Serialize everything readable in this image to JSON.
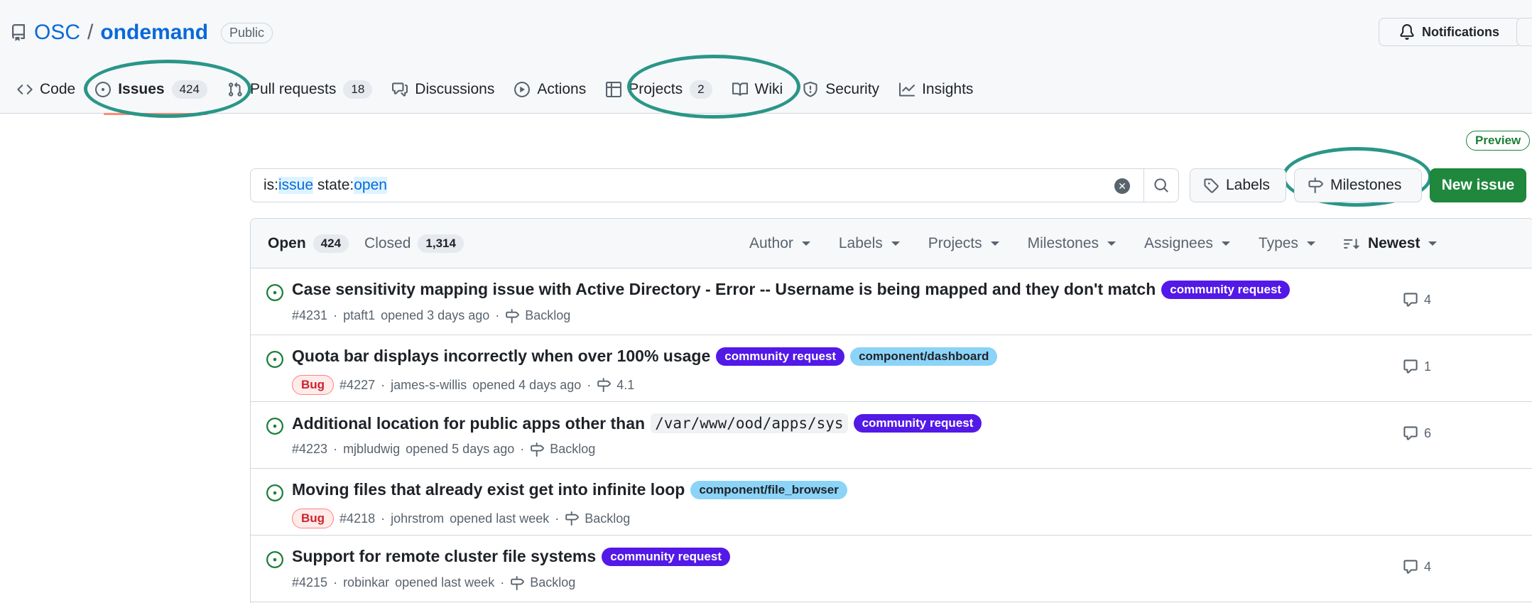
{
  "repo": {
    "owner": "OSC",
    "separator": "/",
    "name": "ondemand",
    "visibility": "Public"
  },
  "header": {
    "notifications_label": "Notifications"
  },
  "tabs": [
    {
      "label": "Code",
      "icon": "code-icon"
    },
    {
      "label": "Issues",
      "count": "424",
      "icon": "issue-opened-icon",
      "selected": true
    },
    {
      "label": "Pull requests",
      "count": "18",
      "icon": "git-pull-request-icon"
    },
    {
      "label": "Discussions",
      "icon": "comment-discussion-icon"
    },
    {
      "label": "Actions",
      "icon": "play-icon"
    },
    {
      "label": "Projects",
      "count": "2",
      "icon": "table-icon"
    },
    {
      "label": "Wiki",
      "icon": "book-icon"
    },
    {
      "label": "Security",
      "icon": "shield-icon"
    },
    {
      "label": "Insights",
      "icon": "graph-icon"
    }
  ],
  "toolbar": {
    "preview_badge": "Preview",
    "search": {
      "k1": "is:",
      "v1": "issue",
      "k2": " state:",
      "v2": "open"
    },
    "labels_button": "Labels",
    "milestones_button": "Milestones",
    "new_issue_button": "New issue"
  },
  "list": {
    "open_label": "Open",
    "open_count": "424",
    "closed_label": "Closed",
    "closed_count": "1,314",
    "filters": [
      "Author",
      "Labels",
      "Projects",
      "Milestones",
      "Assignees",
      "Types"
    ],
    "sort_label": "Newest"
  },
  "issues": [
    {
      "title": "Case sensitivity mapping issue with Active Directory - Error -- Username is being mapped and they don't match",
      "labels": [
        {
          "name": "community request",
          "kind": "community"
        }
      ],
      "bug": false,
      "number": "#4231",
      "author": "ptaft1",
      "opened": "opened 3 days ago",
      "milestone": "Backlog",
      "comments": "4"
    },
    {
      "title": "Quota bar displays incorrectly when over 100% usage",
      "labels": [
        {
          "name": "community request",
          "kind": "community"
        },
        {
          "name": "component/dashboard",
          "kind": "component"
        }
      ],
      "bug": true,
      "bug_label": "Bug",
      "number": "#4227",
      "author": "james-s-willis",
      "opened": "opened 4 days ago",
      "milestone": "4.1",
      "comments": "1"
    },
    {
      "title": "Additional location for public apps other than",
      "code": "/var/www/ood/apps/sys",
      "labels": [
        {
          "name": "community request",
          "kind": "community"
        }
      ],
      "bug": false,
      "number": "#4223",
      "author": "mjbludwig",
      "opened": "opened 5 days ago",
      "milestone": "Backlog",
      "comments": "6"
    },
    {
      "title": "Moving files that already exist get into infinite loop",
      "labels": [
        {
          "name": "component/file_browser",
          "kind": "component"
        }
      ],
      "bug": true,
      "bug_label": "Bug",
      "number": "#4218",
      "author": "johrstrom",
      "opened": "opened last week",
      "milestone": "Backlog",
      "comments": ""
    },
    {
      "title": "Support for remote cluster file systems",
      "labels": [
        {
          "name": "community request",
          "kind": "community"
        }
      ],
      "bug": false,
      "number": "#4215",
      "author": "robinkar",
      "opened": "opened last week",
      "milestone": "Backlog",
      "comments": "4"
    }
  ],
  "colors": {
    "annotation": "#2a9688",
    "accent": "#0969da",
    "open_green": "#1a7f37",
    "new_issue_bg": "#1f883d",
    "community": "#5319e7",
    "component": "#8cd3f8"
  }
}
